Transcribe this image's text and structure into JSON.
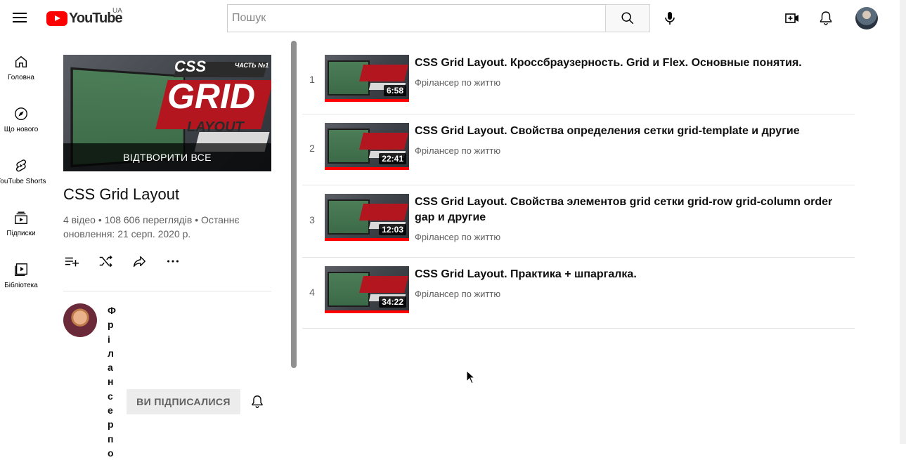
{
  "header": {
    "logo_text": "YouTube",
    "region": "UA",
    "search_placeholder": "Пошук"
  },
  "guide": [
    {
      "label": "Головна",
      "icon": "home-icon"
    },
    {
      "label": "Що нового",
      "icon": "compass-icon"
    },
    {
      "label": "YouTube Shorts",
      "icon": "shorts-icon"
    },
    {
      "label": "Підписки",
      "icon": "subscriptions-icon"
    },
    {
      "label": "Бібліотека",
      "icon": "library-icon"
    }
  ],
  "playlist": {
    "thumb_words": [
      "CSS",
      "GRID",
      "LAYOUT",
      "ЧАСТЬ №1"
    ],
    "play_all": "ВІДТВОРИТИ ВСЕ",
    "title": "CSS Grid Layout",
    "stats": "4 відео • 108 606 переглядів • Останнє оновлення: 21 серп. 2020 р.",
    "owner": "Фрілансерпо",
    "subscribed_label": "ВИ ПІДПИСАЛИСЯ"
  },
  "videos": [
    {
      "index": "1",
      "title": "CSS Grid Layout. Кроссбраузерность. Grid и Flex. Основные понятия.",
      "channel": "Фрілансер по життю",
      "duration": "6:58"
    },
    {
      "index": "2",
      "title": "CSS Grid Layout. Свойства определения сетки grid-template и другие",
      "channel": "Фрілансер по життю",
      "duration": "22:41"
    },
    {
      "index": "3",
      "title": "CSS Grid Layout. Свойства элементов grid сетки grid-row grid-column order gap и другие",
      "channel": "Фрілансер по життю",
      "duration": "12:03"
    },
    {
      "index": "4",
      "title": "CSS Grid Layout. Практика + шпаргалка.",
      "channel": "Фрілансер по життю",
      "duration": "34:22"
    }
  ],
  "colors": {
    "brand_red": "#ff0000",
    "thumb_banner": "#b3161f"
  }
}
